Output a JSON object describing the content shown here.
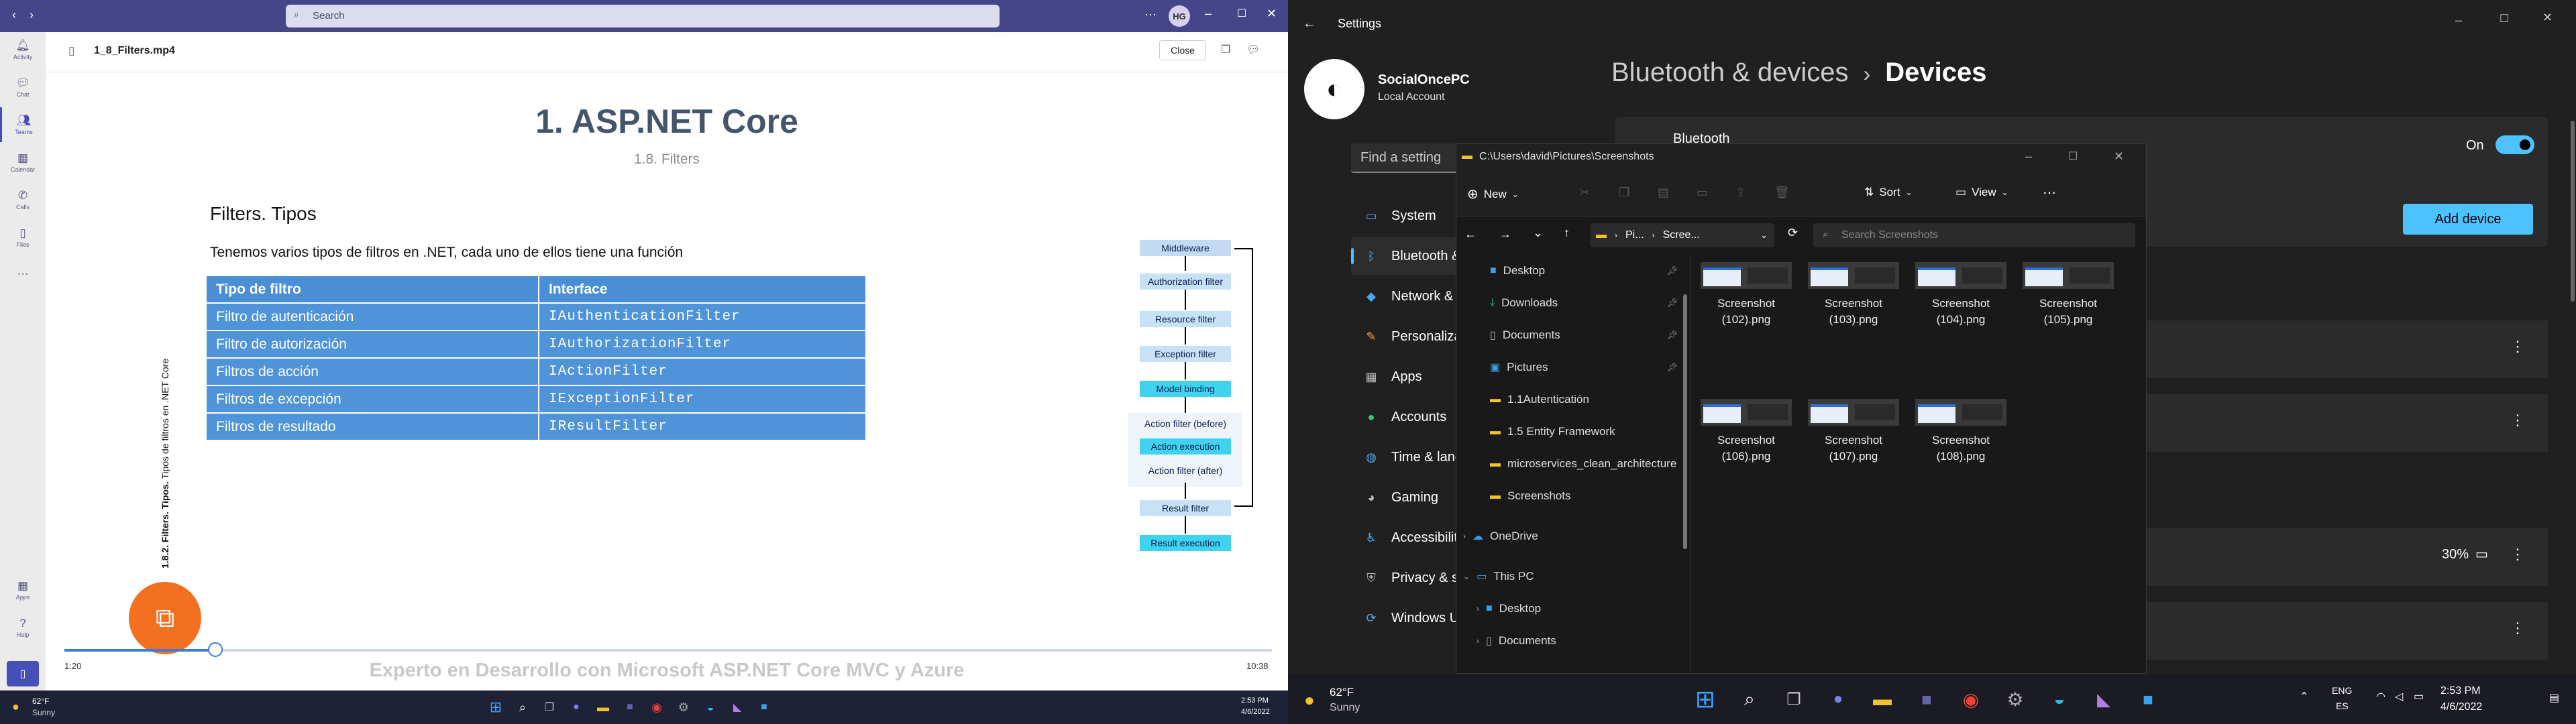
{
  "left_screen": {
    "teams": {
      "search_placeholder": "Search",
      "avatar_initials": "HG",
      "rail": [
        "Activity",
        "Chat",
        "Teams",
        "Calendar",
        "Calls",
        "Files",
        "Apps",
        "Help"
      ],
      "file_name": "1_8_Filters.mp4",
      "close_label": "Close"
    },
    "slide": {
      "title": "1. ASP.NET Core",
      "subtitle": "1.8. Filters",
      "heading": "Filters. Tipos",
      "intro": "Tenemos varios tipos de filtros en .NET, cada uno de ellos tiene una función",
      "table_headers": [
        "Tipo de filtro",
        "Interface"
      ],
      "table_rows": [
        [
          "Filtro de autenticación",
          "IAuthenticationFilter"
        ],
        [
          "Filtro de autorización",
          "IAuthorizationFilter"
        ],
        [
          "Filtros de acción",
          "IActionFilter"
        ],
        [
          "Filtros de excepción",
          "IExceptionFilter"
        ],
        [
          "Filtros de resultado",
          "IResultFilter"
        ]
      ],
      "side_text_bold": "1.8.2. Filters. Tipos.",
      "side_text": " Tipos de filtros en .NET Core",
      "pipeline": [
        "Middleware",
        "Authorization filter",
        "Resource filter",
        "Exception filter",
        "Model binding",
        "Action filter (before)",
        "Action execution",
        "Action filter (after)",
        "Result filter",
        "Result execution"
      ],
      "footer": "Experto en Desarrollo con Microsoft ASP.NET Core MVC y Azure"
    },
    "player": {
      "elapsed": "1:20",
      "total": "10:38",
      "progress": 0.125
    },
    "taskbar": {
      "temp": "62°F",
      "weather": "Sunny",
      "time": "2:53 PM",
      "date": "4/6/2022"
    }
  },
  "right_screen": {
    "settings": {
      "title": "Settings",
      "account_name": "SocialOncePC",
      "account_type": "Local Account",
      "find_placeholder": "Find a setting",
      "nav": [
        "System",
        "Bluetooth & devices",
        "Network & internet",
        "Personalization",
        "Apps",
        "Accounts",
        "Time & language",
        "Gaming",
        "Accessibility",
        "Privacy & security",
        "Windows Update"
      ],
      "breadcrumb_parent": "Bluetooth & devices",
      "breadcrumb_sep": "›",
      "breadcrumb_current": "Devices",
      "bluetooth_label": "Bluetooth",
      "toggle_state": "On",
      "add_device": "Add device",
      "battery": "30%"
    },
    "explorer": {
      "path": "C:\\Users\\david\\Pictures\\Screenshots",
      "toolbar": {
        "new": "New",
        "sort": "Sort",
        "view": "View"
      },
      "address": [
        "Pi...",
        "Scree..."
      ],
      "search_placeholder": "Search Screenshots",
      "nav_items": [
        "Desktop",
        "Downloads",
        "Documents",
        "Pictures",
        "1.1Autenticatión",
        "1.5 Entity Framework",
        "microservices_clean_architecture",
        "Screenshots",
        "OneDrive",
        "This PC",
        "Desktop",
        "Documents"
      ],
      "files": [
        [
          "Screenshot",
          "(102).png"
        ],
        [
          "Screenshot",
          "(103).png"
        ],
        [
          "Screenshot",
          "(104).png"
        ],
        [
          "Screenshot",
          "(105).png"
        ],
        [
          "Screenshot",
          "(106).png"
        ],
        [
          "Screenshot",
          "(107).png"
        ],
        [
          "Screenshot",
          "(108).png"
        ]
      ]
    },
    "taskbar": {
      "temp": "62°F",
      "weather": "Sunny",
      "lang": "ENG",
      "region": "ES",
      "time": "2:53 PM",
      "date": "4/6/2022"
    }
  }
}
